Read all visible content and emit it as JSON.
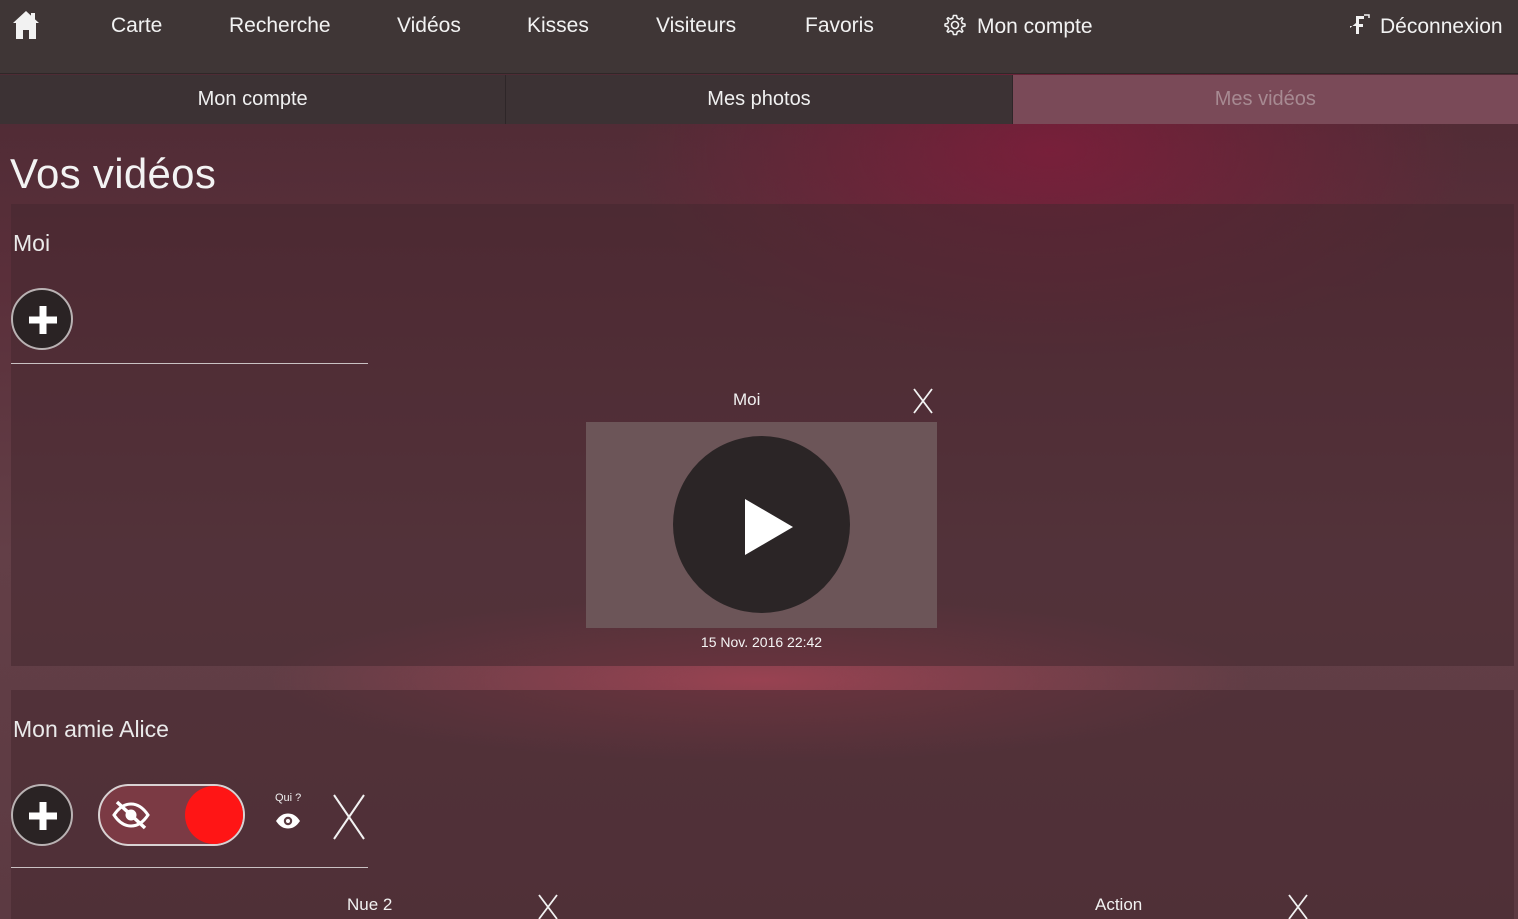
{
  "nav": {
    "items": [
      {
        "label": "Carte"
      },
      {
        "label": "Recherche"
      },
      {
        "label": "Vidéos"
      },
      {
        "label": "Kisses"
      },
      {
        "label": "Visiteurs"
      },
      {
        "label": "Favoris"
      },
      {
        "label": "Mon compte",
        "icon": "gear-icon"
      }
    ],
    "logout": {
      "label": "Déconnexion",
      "icon": "logout-icon"
    },
    "home_icon": "home-icon"
  },
  "subtabs": [
    {
      "label": "Mon compte"
    },
    {
      "label": "Mes photos"
    },
    {
      "label": "Mes vidéos",
      "active": true
    }
  ],
  "page": {
    "title": "Vos vidéos"
  },
  "albums": [
    {
      "name": "Moi",
      "videos": [
        {
          "title": "Moi",
          "date": "15 Nov. 2016 22:42"
        }
      ]
    },
    {
      "name": "Mon amie Alice",
      "privacy": {
        "who_label": "Qui ?"
      },
      "videos": [
        {
          "title": "Nue 2"
        },
        {
          "title": "Action"
        }
      ]
    }
  ],
  "colors": {
    "toggle_knob": "#ff1515",
    "active_tab": "#7a4a58",
    "nav_bg": "#3f3636"
  }
}
